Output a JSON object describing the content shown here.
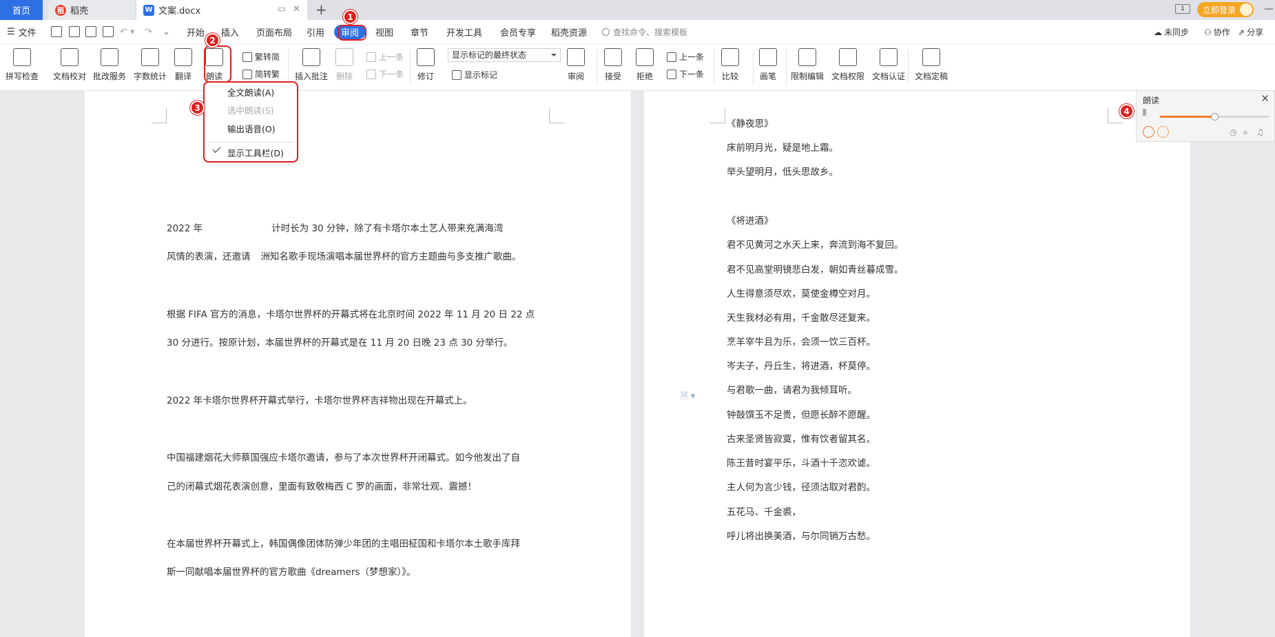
{
  "tabs": {
    "home": "首页",
    "daoke": "稻壳",
    "doc": "文案.docx",
    "new_tab": "+"
  },
  "login_label": "立即登录",
  "menubar": {
    "file": "文件",
    "items": [
      "开始",
      "插入",
      "页面布局",
      "引用",
      "审阅",
      "视图",
      "章节",
      "开发工具",
      "会员专享",
      "稻壳资源"
    ],
    "active": "审阅",
    "search_placeholder": "查找命令、搜索模板",
    "sync": "未同步",
    "collab": "协作",
    "share": "分享"
  },
  "ribbon": {
    "spell": "拼写检查",
    "proofread": "文档校对",
    "revise_service": "批改服务",
    "word_count": "字数统计",
    "translate": "翻译",
    "read_aloud": "朗读",
    "trad_to_simp": "繁转简",
    "simp_to_trad": "简转繁",
    "insert_comment": "插入批注",
    "delete": "删除",
    "prev_comment": "上一条",
    "next_comment": "下一条",
    "revise": "修订",
    "markup_state": "显示标记的最终状态",
    "show_markup": "显示标记",
    "review": "审阅",
    "accept": "接受",
    "reject": "拒绝",
    "prev_change": "上一条",
    "next_change": "下一条",
    "compare": "比较",
    "pen": "画笔",
    "restrict_edit": "限制编辑",
    "doc_permission": "文档权限",
    "doc_certify": "文档认证",
    "doc_finalize": "文档定稿"
  },
  "read_menu": {
    "full_read": "全文朗读(A)",
    "selected_read": "选中朗读(S)",
    "output_voice": "输出语音(O)",
    "show_toolbar": "显示工具栏(D)"
  },
  "badges": [
    "1",
    "2",
    "3",
    "4"
  ],
  "read_panel": {
    "title": "朗读",
    "close": "✕",
    "volume": 0.5
  },
  "page1": {
    "p1_line1_a": "2022 年",
    "p1_line1_b": "计时长为 30 分钟，除了有卡塔尔本土艺人带来充满海湾",
    "p1_line2_a": "风情的表演，还邀请",
    "p1_line2_b": "洲知名歌手现场演唱本届世界杯的官方主题曲与多支推广歌曲。",
    "p2_line1": "根据 FIFA 官方的消息，卡塔尔世界杯的开幕式将在北京时间 2022 年 11 月 20 日 22 点",
    "p2_line2": "30 分进行。按原计划，本届世界杯的开幕式是在 11 月 20 日晚 23 点 30 分举行。",
    "p3_line1": "2022 年卡塔尔世界杯开幕式举行，卡塔尔世界杯吉祥物出现在开幕式上。",
    "p4_line1": "中国福建烟花大师蔡国强应卡塔尔邀请，参与了本次世界杯开闭幕式。如今他发出了自",
    "p4_line2": "己的闭幕式烟花表演创意，里面有致敬梅西 C 罗的画面，非常壮观、震撼！",
    "p5_line1": "在本届世界杯开幕式上，韩国偶像团体防弹少年团的主唱田柾国和卡塔尔本土歌手库拜",
    "p5_line2": "斯一同献唱本届世界杯的官方歌曲《dreamers（梦想家）》。"
  },
  "page2": {
    "lines": [
      "《静夜思》",
      "床前明月光，疑是地上霜。",
      "举头望明月，低头思故乡。",
      "《将进酒》",
      "君不见黄河之水天上来，奔流到海不复回。",
      "君不见高堂明镜悲白发，朝如青丝暮成雪。",
      "人生得意须尽欢，莫使金樽空对月。",
      "天生我材必有用，千金散尽还复来。",
      "烹羊宰牛且为乐，会须一饮三百杯。",
      "岑夫子，丹丘生，将进酒，杯莫停。",
      "与君歌一曲，请君为我倾耳听。",
      "钟鼓馔玉不足贵，但愿长醉不愿醒。",
      "古来圣贤皆寂寞，惟有饮者留其名。",
      "陈王昔时宴平乐，斗酒十千恣欢谑。",
      "主人何为言少钱，径须沽取对君酌。",
      "五花马、千金裘，",
      "呼儿将出换美酒，与尔同销万古愁。"
    ]
  },
  "colors": {
    "accent": "#2f6fe4",
    "highlight": "#e02020",
    "slider": "#f07a2a",
    "login": "#f5a623"
  }
}
